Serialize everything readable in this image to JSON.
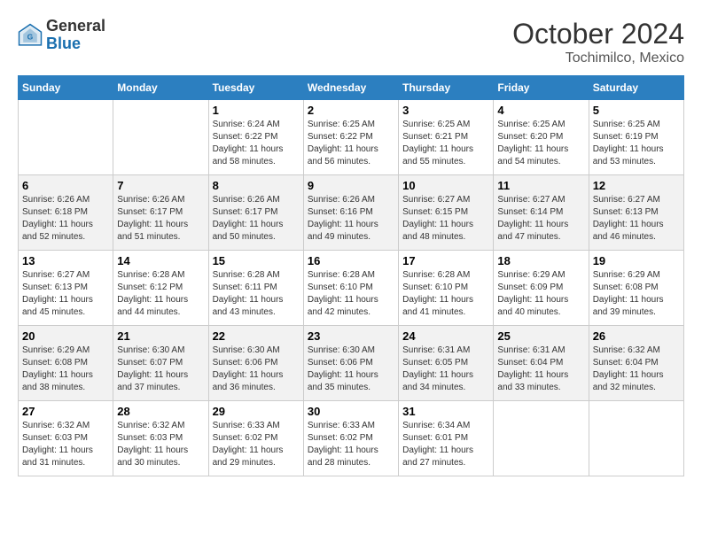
{
  "header": {
    "logo_general": "General",
    "logo_blue": "Blue",
    "month_year": "October 2024",
    "location": "Tochimilco, Mexico"
  },
  "days_of_week": [
    "Sunday",
    "Monday",
    "Tuesday",
    "Wednesday",
    "Thursday",
    "Friday",
    "Saturday"
  ],
  "weeks": [
    {
      "row_index": 0,
      "cells": [
        {
          "day": "",
          "empty": true
        },
        {
          "day": "",
          "empty": true
        },
        {
          "day": "1",
          "sunrise": "Sunrise: 6:24 AM",
          "sunset": "Sunset: 6:22 PM",
          "daylight": "Daylight: 11 hours and 58 minutes."
        },
        {
          "day": "2",
          "sunrise": "Sunrise: 6:25 AM",
          "sunset": "Sunset: 6:22 PM",
          "daylight": "Daylight: 11 hours and 56 minutes."
        },
        {
          "day": "3",
          "sunrise": "Sunrise: 6:25 AM",
          "sunset": "Sunset: 6:21 PM",
          "daylight": "Daylight: 11 hours and 55 minutes."
        },
        {
          "day": "4",
          "sunrise": "Sunrise: 6:25 AM",
          "sunset": "Sunset: 6:20 PM",
          "daylight": "Daylight: 11 hours and 54 minutes."
        },
        {
          "day": "5",
          "sunrise": "Sunrise: 6:25 AM",
          "sunset": "Sunset: 6:19 PM",
          "daylight": "Daylight: 11 hours and 53 minutes."
        }
      ]
    },
    {
      "row_index": 1,
      "cells": [
        {
          "day": "6",
          "sunrise": "Sunrise: 6:26 AM",
          "sunset": "Sunset: 6:18 PM",
          "daylight": "Daylight: 11 hours and 52 minutes."
        },
        {
          "day": "7",
          "sunrise": "Sunrise: 6:26 AM",
          "sunset": "Sunset: 6:17 PM",
          "daylight": "Daylight: 11 hours and 51 minutes."
        },
        {
          "day": "8",
          "sunrise": "Sunrise: 6:26 AM",
          "sunset": "Sunset: 6:17 PM",
          "daylight": "Daylight: 11 hours and 50 minutes."
        },
        {
          "day": "9",
          "sunrise": "Sunrise: 6:26 AM",
          "sunset": "Sunset: 6:16 PM",
          "daylight": "Daylight: 11 hours and 49 minutes."
        },
        {
          "day": "10",
          "sunrise": "Sunrise: 6:27 AM",
          "sunset": "Sunset: 6:15 PM",
          "daylight": "Daylight: 11 hours and 48 minutes."
        },
        {
          "day": "11",
          "sunrise": "Sunrise: 6:27 AM",
          "sunset": "Sunset: 6:14 PM",
          "daylight": "Daylight: 11 hours and 47 minutes."
        },
        {
          "day": "12",
          "sunrise": "Sunrise: 6:27 AM",
          "sunset": "Sunset: 6:13 PM",
          "daylight": "Daylight: 11 hours and 46 minutes."
        }
      ]
    },
    {
      "row_index": 2,
      "cells": [
        {
          "day": "13",
          "sunrise": "Sunrise: 6:27 AM",
          "sunset": "Sunset: 6:13 PM",
          "daylight": "Daylight: 11 hours and 45 minutes."
        },
        {
          "day": "14",
          "sunrise": "Sunrise: 6:28 AM",
          "sunset": "Sunset: 6:12 PM",
          "daylight": "Daylight: 11 hours and 44 minutes."
        },
        {
          "day": "15",
          "sunrise": "Sunrise: 6:28 AM",
          "sunset": "Sunset: 6:11 PM",
          "daylight": "Daylight: 11 hours and 43 minutes."
        },
        {
          "day": "16",
          "sunrise": "Sunrise: 6:28 AM",
          "sunset": "Sunset: 6:10 PM",
          "daylight": "Daylight: 11 hours and 42 minutes."
        },
        {
          "day": "17",
          "sunrise": "Sunrise: 6:28 AM",
          "sunset": "Sunset: 6:10 PM",
          "daylight": "Daylight: 11 hours and 41 minutes."
        },
        {
          "day": "18",
          "sunrise": "Sunrise: 6:29 AM",
          "sunset": "Sunset: 6:09 PM",
          "daylight": "Daylight: 11 hours and 40 minutes."
        },
        {
          "day": "19",
          "sunrise": "Sunrise: 6:29 AM",
          "sunset": "Sunset: 6:08 PM",
          "daylight": "Daylight: 11 hours and 39 minutes."
        }
      ]
    },
    {
      "row_index": 3,
      "cells": [
        {
          "day": "20",
          "sunrise": "Sunrise: 6:29 AM",
          "sunset": "Sunset: 6:08 PM",
          "daylight": "Daylight: 11 hours and 38 minutes."
        },
        {
          "day": "21",
          "sunrise": "Sunrise: 6:30 AM",
          "sunset": "Sunset: 6:07 PM",
          "daylight": "Daylight: 11 hours and 37 minutes."
        },
        {
          "day": "22",
          "sunrise": "Sunrise: 6:30 AM",
          "sunset": "Sunset: 6:06 PM",
          "daylight": "Daylight: 11 hours and 36 minutes."
        },
        {
          "day": "23",
          "sunrise": "Sunrise: 6:30 AM",
          "sunset": "Sunset: 6:06 PM",
          "daylight": "Daylight: 11 hours and 35 minutes."
        },
        {
          "day": "24",
          "sunrise": "Sunrise: 6:31 AM",
          "sunset": "Sunset: 6:05 PM",
          "daylight": "Daylight: 11 hours and 34 minutes."
        },
        {
          "day": "25",
          "sunrise": "Sunrise: 6:31 AM",
          "sunset": "Sunset: 6:04 PM",
          "daylight": "Daylight: 11 hours and 33 minutes."
        },
        {
          "day": "26",
          "sunrise": "Sunrise: 6:32 AM",
          "sunset": "Sunset: 6:04 PM",
          "daylight": "Daylight: 11 hours and 32 minutes."
        }
      ]
    },
    {
      "row_index": 4,
      "cells": [
        {
          "day": "27",
          "sunrise": "Sunrise: 6:32 AM",
          "sunset": "Sunset: 6:03 PM",
          "daylight": "Daylight: 11 hours and 31 minutes."
        },
        {
          "day": "28",
          "sunrise": "Sunrise: 6:32 AM",
          "sunset": "Sunset: 6:03 PM",
          "daylight": "Daylight: 11 hours and 30 minutes."
        },
        {
          "day": "29",
          "sunrise": "Sunrise: 6:33 AM",
          "sunset": "Sunset: 6:02 PM",
          "daylight": "Daylight: 11 hours and 29 minutes."
        },
        {
          "day": "30",
          "sunrise": "Sunrise: 6:33 AM",
          "sunset": "Sunset: 6:02 PM",
          "daylight": "Daylight: 11 hours and 28 minutes."
        },
        {
          "day": "31",
          "sunrise": "Sunrise: 6:34 AM",
          "sunset": "Sunset: 6:01 PM",
          "daylight": "Daylight: 11 hours and 27 minutes."
        },
        {
          "day": "",
          "empty": true
        },
        {
          "day": "",
          "empty": true
        }
      ]
    }
  ]
}
